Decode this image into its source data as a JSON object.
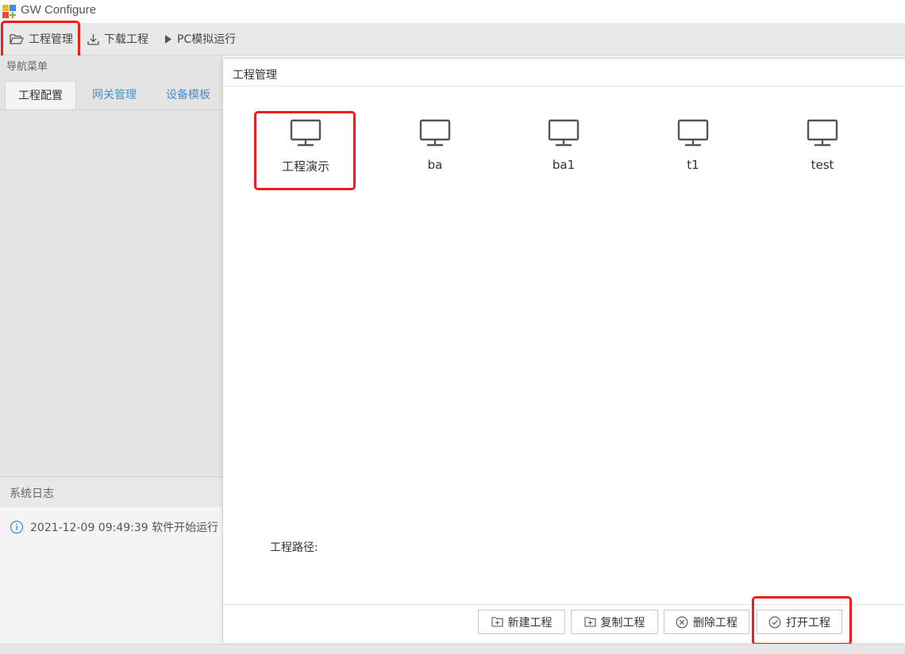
{
  "window": {
    "title": "GW Configure"
  },
  "toolbar": {
    "project_manage": "工程管理",
    "download_project": "下载工程",
    "pc_simulate": "PC模拟运行"
  },
  "nav": {
    "header": "导航菜单",
    "tabs": [
      "工程配置",
      "网关管理",
      "设备模板"
    ]
  },
  "log": {
    "header": "系统日志",
    "entries": [
      "2021-12-09 09:49:39 软件开始运行"
    ]
  },
  "dialog": {
    "title": "工程管理",
    "projects": [
      "工程演示",
      "ba",
      "ba1",
      "t1",
      "test"
    ],
    "path_label": "工程路径:",
    "buttons": {
      "new": "新建工程",
      "copy": "复制工程",
      "delete": "删除工程",
      "open": "打开工程"
    }
  },
  "colors": {
    "highlight": "#ee1c1c",
    "tab_inactive": "#4a8fcf",
    "log_info": "#3b8ad9"
  },
  "icons": {
    "logo": "gw-logo-icon",
    "folder": "folder-open-icon",
    "download": "download-icon",
    "play": "play-icon",
    "monitor": "monitor-icon",
    "info": "info-icon"
  }
}
